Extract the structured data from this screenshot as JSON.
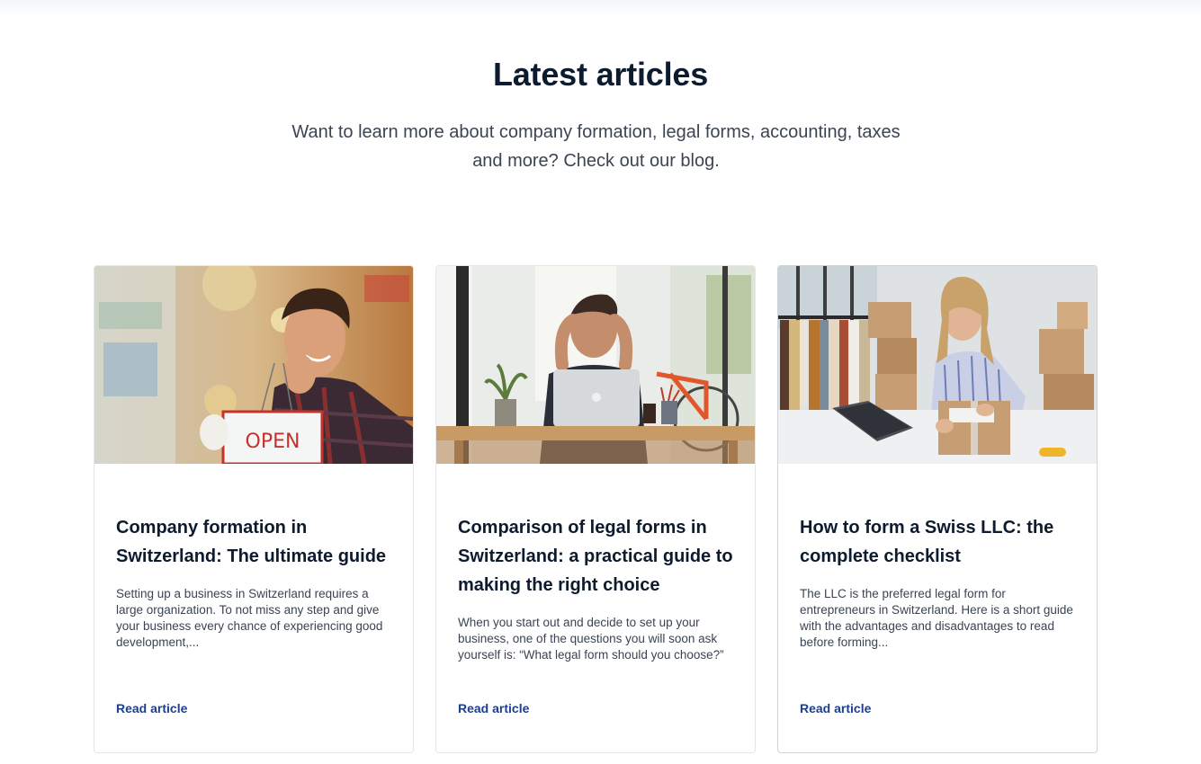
{
  "section": {
    "title": "Latest articles",
    "subtitle_line1": "Want to learn more about company formation, legal forms, accounting, taxes",
    "subtitle_line2": "and more? Check out our blog."
  },
  "articles": [
    {
      "title": "Company formation in Switzerland: The ultimate guide",
      "excerpt": "Setting up a business in Switzerland requires a large organization. To not miss any step and give your business every chance of experiencing good development,...",
      "link_label": "Read article",
      "image_sign_text": "OPEN"
    },
    {
      "title": "Comparison of legal forms in Switzerland: a practical guide to making the right choice",
      "excerpt": "When you start out and decide to set up your business, one of the questions you will soon ask yourself is: “What legal form should you choose?”",
      "link_label": "Read article"
    },
    {
      "title": "How to form a Swiss LLC: the complete checklist",
      "excerpt": "The LLC is the preferred legal form for entrepreneurs in Switzerland. Here is a short guide with the advantages and disadvantages to read before forming...",
      "link_label": "Read article"
    }
  ],
  "colors": {
    "heading": "#0d1b2e",
    "body_text": "#3b4452",
    "link": "#1d3f8a",
    "card_border": "#e3e6ea"
  }
}
